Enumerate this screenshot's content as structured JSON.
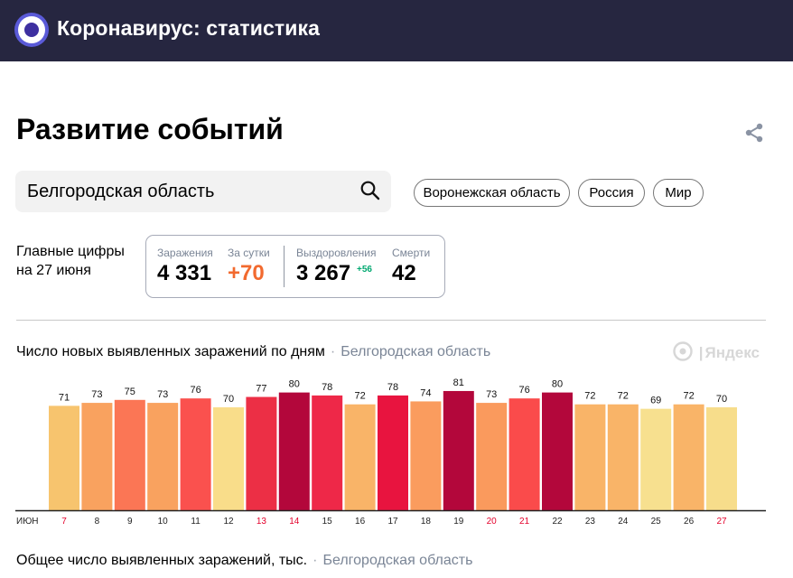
{
  "header": {
    "title": "Коронавирус: статистика",
    "logo_icon": "coronavirus-logo-icon"
  },
  "page": {
    "heading": "Развитие событий",
    "share_icon": "share-icon"
  },
  "search": {
    "value": "Белгородская область",
    "icon": "search-icon"
  },
  "region_chips": [
    "Воронежская область",
    "Россия",
    "Мир"
  ],
  "main_figures": {
    "label_line1": "Главные цифры",
    "label_line2": "на 27 июня",
    "infections_label": "Заражения",
    "infections_value": "4 331",
    "daily_label": "За сутки",
    "daily_value": "+70",
    "recovered_label": "Выздоровления",
    "recovered_value": "3 267",
    "recovered_delta": "+56",
    "deaths_label": "Смерти",
    "deaths_value": "42"
  },
  "chart1": {
    "title": "Число новых выявленных заражений по дням",
    "separator": "·",
    "region": "Белгородская область",
    "watermark": "Яндекс"
  },
  "chart_data": {
    "type": "bar",
    "month_label": "ИЮН",
    "categories": [
      "7",
      "8",
      "9",
      "10",
      "11",
      "12",
      "13",
      "14",
      "15",
      "16",
      "17",
      "18",
      "19",
      "20",
      "21",
      "22",
      "23",
      "24",
      "25",
      "26",
      "27"
    ],
    "values": [
      71,
      73,
      75,
      73,
      76,
      70,
      77,
      80,
      78,
      72,
      78,
      74,
      81,
      73,
      76,
      80,
      72,
      72,
      69,
      72,
      70
    ],
    "weekend_days": [
      "7",
      "13",
      "14",
      "20",
      "21",
      "27"
    ],
    "bar_colors": [
      "#f7c46e",
      "#f9a25f",
      "#fb7655",
      "#f9a25f",
      "#fa514e",
      "#f9dd8a",
      "#ec2f45",
      "#b3073b",
      "#ee2848",
      "#f9b468",
      "#e8143f",
      "#fa9c5e",
      "#b3073b",
      "#fa9a5d",
      "#fa4b4b",
      "#b3073b",
      "#f9b468",
      "#f9b468",
      "#f7e08f",
      "#f9b468",
      "#f7dd8b"
    ],
    "weekend_color": "#e4002b",
    "axis_color": "#222222"
  },
  "chart2": {
    "title": "Общее число выявленных заражений, тыс.",
    "separator": "·",
    "region": "Белгородская область"
  }
}
